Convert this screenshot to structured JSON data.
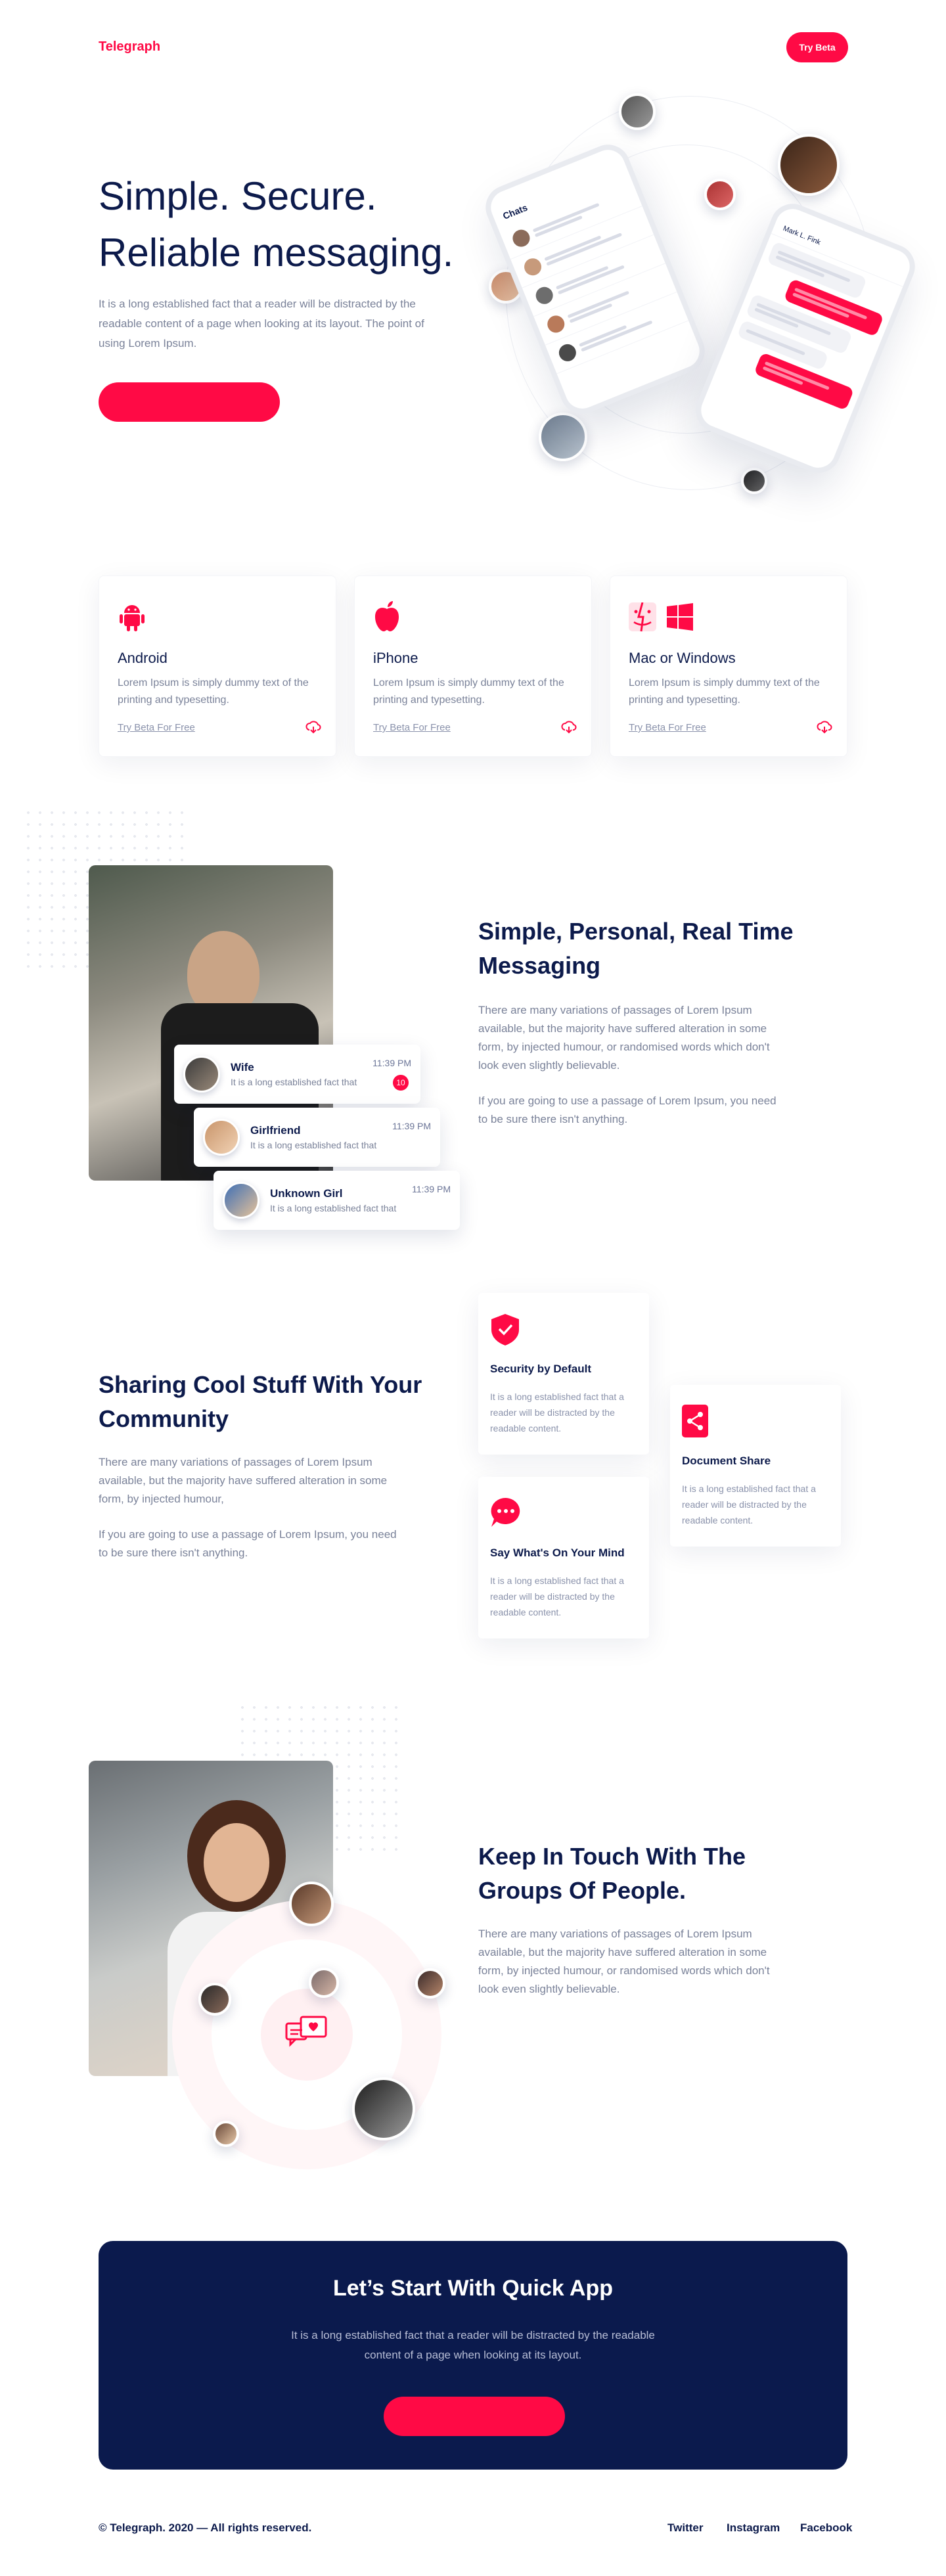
{
  "brand": {
    "name": "Telegraph",
    "color": "#ff0a45",
    "navy": "#0c1a4b"
  },
  "header": {
    "try_beta_label": "Try Beta"
  },
  "hero": {
    "title_line1": "Simple. Secure.",
    "title_line2": "Reliable messaging.",
    "subtitle": "It is a long established fact that a reader will be distracted by the readable content of a page when looking at its layout. The point of using Lorem Ipsum.",
    "phone_left": {
      "header": "Chats"
    },
    "phone_right": {
      "header": "Mark L. Fink"
    }
  },
  "platforms": [
    {
      "icon": "android-icon",
      "title": "Android",
      "text": "Lorem Ipsum is simply dummy text of the printing and typesetting.",
      "link": "Try Beta For Free"
    },
    {
      "icon": "apple-icon",
      "title": "iPhone",
      "text": "Lorem Ipsum is simply dummy text of the printing and typesetting.",
      "link": "Try Beta For Free"
    },
    {
      "icon": "mac-windows-icon",
      "title": "Mac or Windows",
      "text": "Lorem Ipsum is simply dummy text of the printing and typesetting.",
      "link": "Try Beta For Free"
    }
  ],
  "realtime": {
    "title_line1": "Simple, Personal, Real Time",
    "title_line2": "Messaging",
    "para1": "There are many variations of passages of Lorem Ipsum available, but the majority have suffered alteration in some form, by injected humour, or randomised words which don't look even slightly believable.",
    "para2": "If you are going to use a passage of Lorem Ipsum, you need to be sure there isn't anything.",
    "messages": [
      {
        "name": "Wife",
        "text": "It is a long established fact that",
        "time": "11:39 PM",
        "badge": "10"
      },
      {
        "name": "Girlfriend",
        "text": "It is a long established fact that",
        "time": "11:39 PM"
      },
      {
        "name": "Unknown Girl",
        "text": "It is a long established fact that",
        "time": "11:39 PM"
      }
    ]
  },
  "community": {
    "title_line1": "Sharing Cool Stuff With Your",
    "title_line2": "Community",
    "para1": "There are many variations of passages of Lorem Ipsum available, but the majority have suffered alteration in some form, by injected humour,",
    "para2": "If you are going to use a passage of Lorem Ipsum, you need to be sure there isn't anything.",
    "features": [
      {
        "icon": "shield-icon",
        "title": "Security by Default",
        "text": "It is a long established fact that a reader will be distracted by the readable content."
      },
      {
        "icon": "share-icon",
        "title": "Document Share",
        "text": "It is a long established fact that a reader will be distracted by the readable content."
      },
      {
        "icon": "chat-bubble-icon",
        "title": "Say What's On Your Mind",
        "text": "It is a long established fact that a reader will be distracted by the readable content."
      }
    ]
  },
  "groups": {
    "title_line1": "Keep In Touch With The",
    "title_line2": "Groups Of People.",
    "para1": "There are many variations of passages of Lorem Ipsum available, but the majority have suffered alteration in some form, by injected humour, or randomised words which don't look even slightly believable."
  },
  "banner": {
    "title": "Let’s Start With Quick App",
    "text": "It is a long established fact that a reader will be distracted by the readable content of a page when looking at its layout."
  },
  "footer": {
    "copyright": "© Telegraph. 2020 — All rights reserved.",
    "links": [
      "Twitter",
      "Instagram",
      "Facebook"
    ]
  }
}
